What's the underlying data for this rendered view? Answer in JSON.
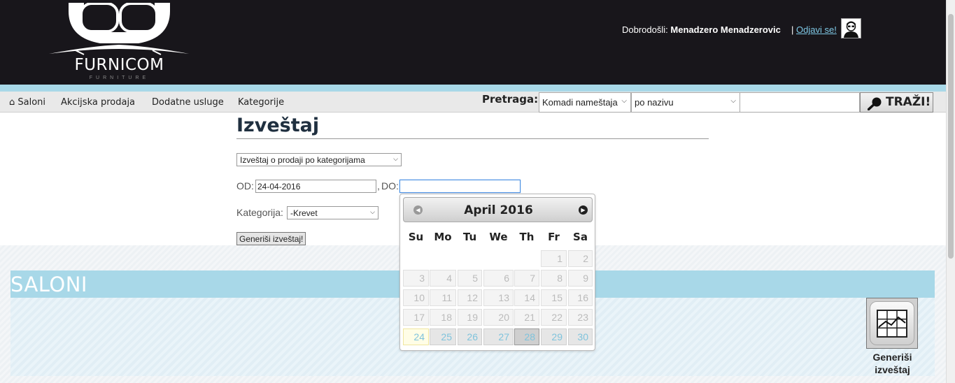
{
  "header": {
    "logo_text": "FURNICOM",
    "logo_sub": "FURNITURE",
    "welcome_prefix": "Dobrodošli:",
    "user_name": "Menadzero Menadzerovic",
    "separator": "|",
    "logout": "Odjavi se!"
  },
  "nav": {
    "items": [
      {
        "label": "⌂ Saloni"
      },
      {
        "label": "Akcijska prodaja"
      },
      {
        "label": "Dodatne usluge"
      },
      {
        "label": "Kategorije"
      }
    ],
    "search_label": "Pretraga:",
    "search_type": "Komadi nameštaja",
    "search_by": "po nazivu",
    "search_value": "",
    "search_button": "TRAŽI!"
  },
  "report": {
    "title": "Izveštaj",
    "type_selected": "Izveštaj o prodaji po kategorijama",
    "od_label": "OD:",
    "od_value": "24-04-2016",
    "do_sep": ",",
    "do_label": "DO:",
    "do_value": "",
    "category_label": "Kategorija:",
    "category_selected": "-Krevet",
    "generate_button": "Generiši izveštaj!"
  },
  "datepicker": {
    "month_title": "April 2016",
    "weekdays": [
      "Su",
      "Mo",
      "Tu",
      "We",
      "Th",
      "Fr",
      "Sa"
    ],
    "weeks": [
      [
        "",
        "",
        "",
        "",
        "",
        "1",
        "2"
      ],
      [
        "3",
        "4",
        "5",
        "6",
        "7",
        "8",
        "9"
      ],
      [
        "10",
        "11",
        "12",
        "13",
        "14",
        "15",
        "16"
      ],
      [
        "17",
        "18",
        "19",
        "20",
        "21",
        "22",
        "23"
      ],
      [
        "24",
        "25",
        "26",
        "27",
        "28",
        "29",
        "30"
      ]
    ]
  },
  "saloni": {
    "title": "SALONI",
    "generate_label": "Generiši izveštaj"
  },
  "colors": {
    "header_bg": "#18161b",
    "accent": "#a8d8e8",
    "link": "#7fc9e6"
  }
}
